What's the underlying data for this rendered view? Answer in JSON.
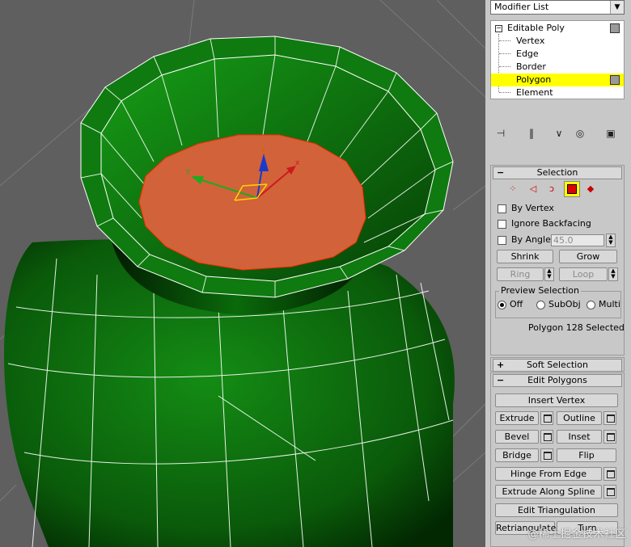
{
  "modifier_list": {
    "label": "Modifier List"
  },
  "stack": {
    "root": "Editable Poly",
    "items": [
      "Vertex",
      "Edge",
      "Border",
      "Polygon",
      "Element"
    ],
    "selected": "Polygon"
  },
  "selection": {
    "title": "Selection",
    "by_vertex": "By Vertex",
    "ignore_backfacing": "Ignore Backfacing",
    "by_angle": "By Angle:",
    "angle_value": "45.0",
    "shrink": "Shrink",
    "grow": "Grow",
    "ring": "Ring",
    "loop": "Loop",
    "preview_title": "Preview Selection",
    "preview_options": [
      "Off",
      "SubObj",
      "Multi"
    ],
    "preview_selected": "Off",
    "status": "Polygon 128 Selected"
  },
  "soft_selection": {
    "title": "Soft Selection"
  },
  "edit_polygons": {
    "title": "Edit Polygons",
    "insert_vertex": "Insert Vertex",
    "extrude": "Extrude",
    "outline": "Outline",
    "bevel": "Bevel",
    "inset": "Inset",
    "bridge": "Bridge",
    "flip": "Flip",
    "hinge_from_edge": "Hinge From Edge",
    "extrude_along_spline": "Extrude Along Spline",
    "edit_triangulation": "Edit Triangulation",
    "retriangulate": "Retriangulate",
    "turn": "Turn"
  },
  "gizmo": {
    "x": "x",
    "y": "y",
    "z": "z"
  },
  "watermark": "@稀土掘金技术社区",
  "colors": {
    "mesh_green": "#0f7a0f",
    "selected_face": "#d2623a",
    "highlight": "#ffff00",
    "panel": "#c8c8c8"
  }
}
